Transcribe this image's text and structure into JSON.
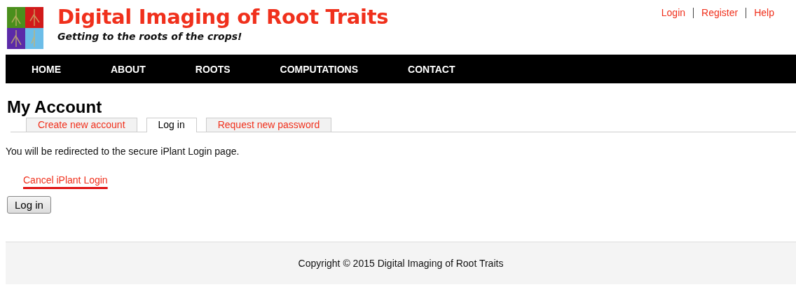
{
  "site": {
    "title": "Digital Imaging of Root Traits",
    "slogan": "Getting to the roots of the crops!"
  },
  "user_links": [
    "Login",
    "Register",
    "Help"
  ],
  "nav": [
    "HOME",
    "ABOUT",
    "ROOTS",
    "COMPUTATIONS",
    "CONTACT"
  ],
  "page_title": "My Account",
  "tabs": [
    {
      "label": "Create new account",
      "selected": false
    },
    {
      "label": "Log in",
      "selected": true
    },
    {
      "label": "Request new password",
      "selected": false
    }
  ],
  "message": "You will be redirected to the secure iPlant Login page.",
  "cancel_link": "Cancel iPlant Login",
  "submit_button": "Log in",
  "footer": "Copyright © 2015 Digital Imaging of Root Traits"
}
